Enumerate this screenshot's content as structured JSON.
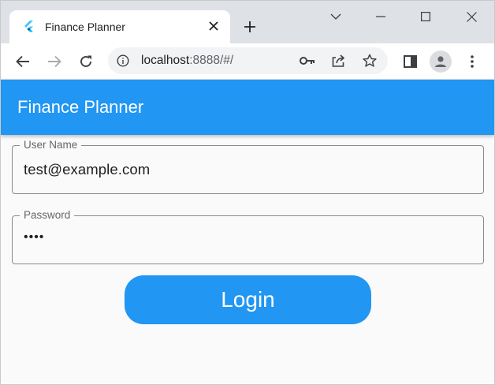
{
  "browser": {
    "tab_title": "Finance Planner",
    "url_host": "localhost",
    "url_rest": ":8888/#/"
  },
  "app": {
    "title": "Finance Planner",
    "accent_color": "#2196f3"
  },
  "form": {
    "username": {
      "label": "User Name",
      "value": "test@example.com"
    },
    "password": {
      "label": "Password",
      "value": "••••"
    },
    "login_label": "Login"
  },
  "icons": {
    "favicon": "flutter-logo-icon",
    "tab_close": "close-icon",
    "new_tab": "plus-icon",
    "back": "arrow-left-icon",
    "forward": "arrow-right-icon",
    "reload": "reload-icon",
    "site_info": "info-icon",
    "password_key": "key-icon",
    "share": "share-icon",
    "bookmark": "star-icon",
    "side_panel": "side-panel-icon",
    "profile": "person-icon",
    "menu": "kebab-menu-icon"
  }
}
